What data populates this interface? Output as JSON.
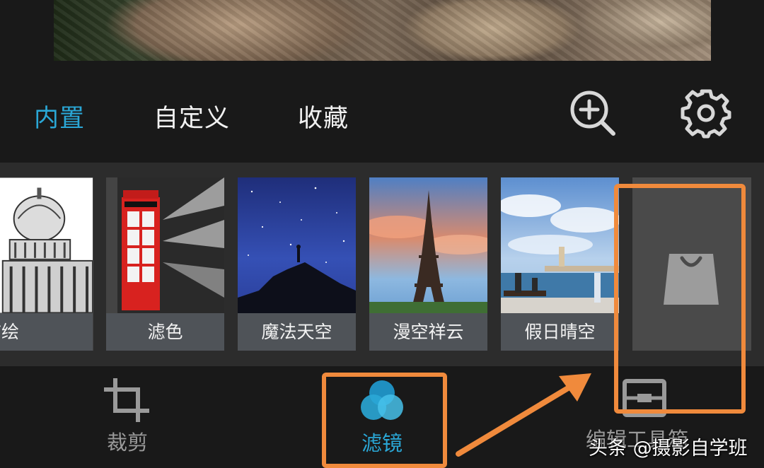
{
  "tabs": [
    {
      "label": "内置",
      "active": true
    },
    {
      "label": "自定义",
      "active": false
    },
    {
      "label": "收藏",
      "active": false
    }
  ],
  "toolbar": {
    "zoom_icon": "zoom-in-icon",
    "settings_icon": "gear-icon"
  },
  "filters": [
    {
      "label": "描绘"
    },
    {
      "label": "滤色"
    },
    {
      "label": "魔法天空"
    },
    {
      "label": "漫空祥云"
    },
    {
      "label": "假日晴空"
    }
  ],
  "store_icon": "shopping-bag-icon",
  "bottom_nav": {
    "crop_label": "裁剪",
    "filter_label": "滤镜",
    "edit_label": "编辑工具箱"
  },
  "watermark": "头条 @摄影自学班",
  "colors": {
    "accent": "#2aa7d6",
    "highlight": "#f08a3c",
    "background": "#191919"
  }
}
